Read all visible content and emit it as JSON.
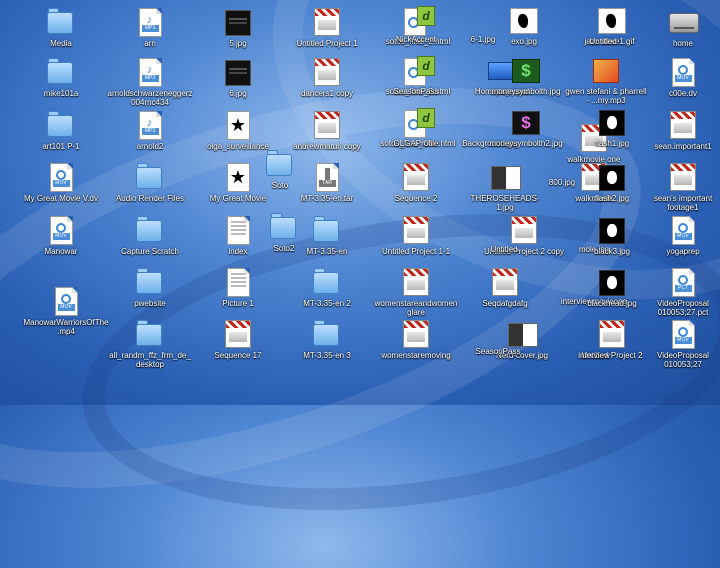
{
  "desktop": {
    "icons": [
      {
        "id": "media",
        "label": "Media",
        "kind": "folder"
      },
      {
        "id": "mike101a",
        "label": "mike101a",
        "kind": "folder"
      },
      {
        "id": "art101",
        "label": "art101 P-1",
        "kind": "folder"
      },
      {
        "id": "my-great-movie-dv",
        "label": "My Great Movie V.dv",
        "kind": "movie"
      },
      {
        "id": "manowar",
        "label": "Manowar",
        "kind": "movie"
      },
      {
        "id": "manowar-mp4",
        "label": "ManowarWarriorsOfThe.mp4",
        "kind": "movie"
      },
      {
        "id": "arn",
        "label": "arn",
        "kind": "audio"
      },
      {
        "id": "arnold-rnc",
        "label": "arnoldschwarzeneggerz004rnc434",
        "kind": "audio"
      },
      {
        "id": "arnold2",
        "label": "arnold2",
        "kind": "audio"
      },
      {
        "id": "audio-render",
        "label": "Audio Render Files",
        "kind": "folder"
      },
      {
        "id": "capture-scratch",
        "label": "Capture Scratch",
        "kind": "folder"
      },
      {
        "id": "pwebsite",
        "label": "pwebsite",
        "kind": "folder"
      },
      {
        "id": "all-randm",
        "label": "all_randm_ffz_frm_de_desktop",
        "kind": "folder"
      },
      {
        "id": "5jpg",
        "label": "5.jpg",
        "kind": "darkimg"
      },
      {
        "id": "6jpg",
        "label": "6.jpg",
        "kind": "darkimg"
      },
      {
        "id": "olga",
        "label": "olga_surveillance",
        "kind": "star"
      },
      {
        "id": "my-great-movie",
        "label": "My Great Movie",
        "kind": "star"
      },
      {
        "id": "index",
        "label": "index",
        "kind": "text"
      },
      {
        "id": "picture1",
        "label": "Picture 1",
        "kind": "text"
      },
      {
        "id": "sequence17",
        "label": "Sequence 17",
        "kind": "project"
      },
      {
        "id": "soto",
        "label": "Soto",
        "kind": "folder"
      },
      {
        "id": "soto2",
        "label": "Soto2",
        "kind": "folder"
      },
      {
        "id": "untitled-project-1",
        "label": "Untitled Project 1",
        "kind": "project"
      },
      {
        "id": "dancers1",
        "label": "dancers1 copy",
        "kind": "project"
      },
      {
        "id": "andrewmaturi",
        "label": "andrewmaturi copy",
        "kind": "project"
      },
      {
        "id": "mt-tar",
        "label": "MT-3.35-en.tar",
        "kind": "archive"
      },
      {
        "id": "mt-en",
        "label": "MT-3.35-en",
        "kind": "folder"
      },
      {
        "id": "mt-en2",
        "label": "MT-3.35-en 2",
        "kind": "folder"
      },
      {
        "id": "mt-en3",
        "label": "MT-3.35-en 3",
        "kind": "folder"
      },
      {
        "id": "sotos-final-2",
        "label": "sotos_final_2.html",
        "kind": "html"
      },
      {
        "id": "sotos-final-3",
        "label": "sotos_final_3.html",
        "kind": "html"
      },
      {
        "id": "sotos-final-one",
        "label": "sotos_final_One.html",
        "kind": "html"
      },
      {
        "id": "sequence2",
        "label": "Sequence 2",
        "kind": "project"
      },
      {
        "id": "untitled-project-1-1",
        "label": "Untitled Project 1-1",
        "kind": "project"
      },
      {
        "id": "womenstare",
        "label": "womenstareandwomenglare",
        "kind": "project"
      },
      {
        "id": "womenstaremoving",
        "label": "womenstaremoving",
        "kind": "project"
      },
      {
        "id": "nickaccent",
        "label": "NickAccent",
        "kind": "none"
      },
      {
        "id": "seasonpass",
        "label": "SeasonPass",
        "kind": "none"
      },
      {
        "id": "olgaprofile",
        "label": "OLGAProfile",
        "kind": "none"
      },
      {
        "id": "6-1jpg",
        "label": "6-1.jpg",
        "kind": "none"
      },
      {
        "id": "exojpg",
        "label": "exo.jpg",
        "kind": "thumb-wb"
      },
      {
        "id": "homepage",
        "label": "Homepage.psd",
        "kind": "thumb-blue"
      },
      {
        "id": "moneysymbol",
        "label": "moneysymbolth.jpg",
        "kind": "thumb-money"
      },
      {
        "id": "backgroundx",
        "label": "Background.jpg",
        "kind": "none"
      },
      {
        "id": "moneysymbol2",
        "label": "moneysymbolth2.jpg",
        "kind": "thumb-money2"
      },
      {
        "id": "theroseheads",
        "label": "THEROSEHEADS-1.jpg",
        "kind": "thumb-mix"
      },
      {
        "id": "x800jpg",
        "label": "800.jpg",
        "kind": "none"
      },
      {
        "id": "untitled-project-2-copy",
        "label": "Untitled Project 2 copy",
        "kind": "project"
      },
      {
        "id": "untitled-bg",
        "label": "Untitled",
        "kind": "none"
      },
      {
        "id": "seqdafgdafg",
        "label": "Seqdafgdafg",
        "kind": "project"
      },
      {
        "id": "newcover",
        "label": "Nerd-cover.jpg",
        "kind": "thumb-mix"
      },
      {
        "id": "seasonpass2",
        "label": "SeasonPass",
        "kind": "none"
      },
      {
        "id": "jazz-slave",
        "label": "jazz slave",
        "kind": "none"
      },
      {
        "id": "untitled1gif",
        "label": "Untitled-1.gif",
        "kind": "thumb-wb"
      },
      {
        "id": "gwen",
        "label": "gwen stefani & pharrell - ...my.mp3",
        "kind": "thumb-red"
      },
      {
        "id": "walkmovieone",
        "label": "walkmovie one",
        "kind": "project"
      },
      {
        "id": "flash1jpg",
        "label": "flash1.jpg",
        "kind": "thumb-blk"
      },
      {
        "id": "walkmovie",
        "label": "walkmovie",
        "kind": "project"
      },
      {
        "id": "flash2jpg",
        "label": "flash2.jpg",
        "kind": "thumb-blk"
      },
      {
        "id": "mole",
        "label": "mole.jpg",
        "kind": "none"
      },
      {
        "id": "black3",
        "label": "black3.jpg",
        "kind": "thumb-blk"
      },
      {
        "id": "interviewone",
        "label": "interviewmovieone",
        "kind": "none"
      },
      {
        "id": "blackhead",
        "label": "blackhead.jpg",
        "kind": "thumb-blk"
      },
      {
        "id": "untitled-project-2",
        "label": "Untitled Project 2",
        "kind": "project"
      },
      {
        "id": "interview",
        "label": "interview",
        "kind": "none"
      },
      {
        "id": "home",
        "label": "home",
        "kind": "hd"
      },
      {
        "id": "c00edv",
        "label": "c00e.dv",
        "kind": "movie"
      },
      {
        "id": "sean-important1",
        "label": "sean.important1",
        "kind": "project"
      },
      {
        "id": "sean-important-footage",
        "label": "sean's important footage1",
        "kind": "project"
      },
      {
        "id": "yogaprep",
        "label": "yogaprep",
        "kind": "movie"
      },
      {
        "id": "videoproposal-pct",
        "label": "VideoProposal 010053;27.pct",
        "kind": "doc"
      },
      {
        "id": "videoproposal",
        "label": "VideoProposal 010053;27",
        "kind": "movie"
      }
    ]
  }
}
